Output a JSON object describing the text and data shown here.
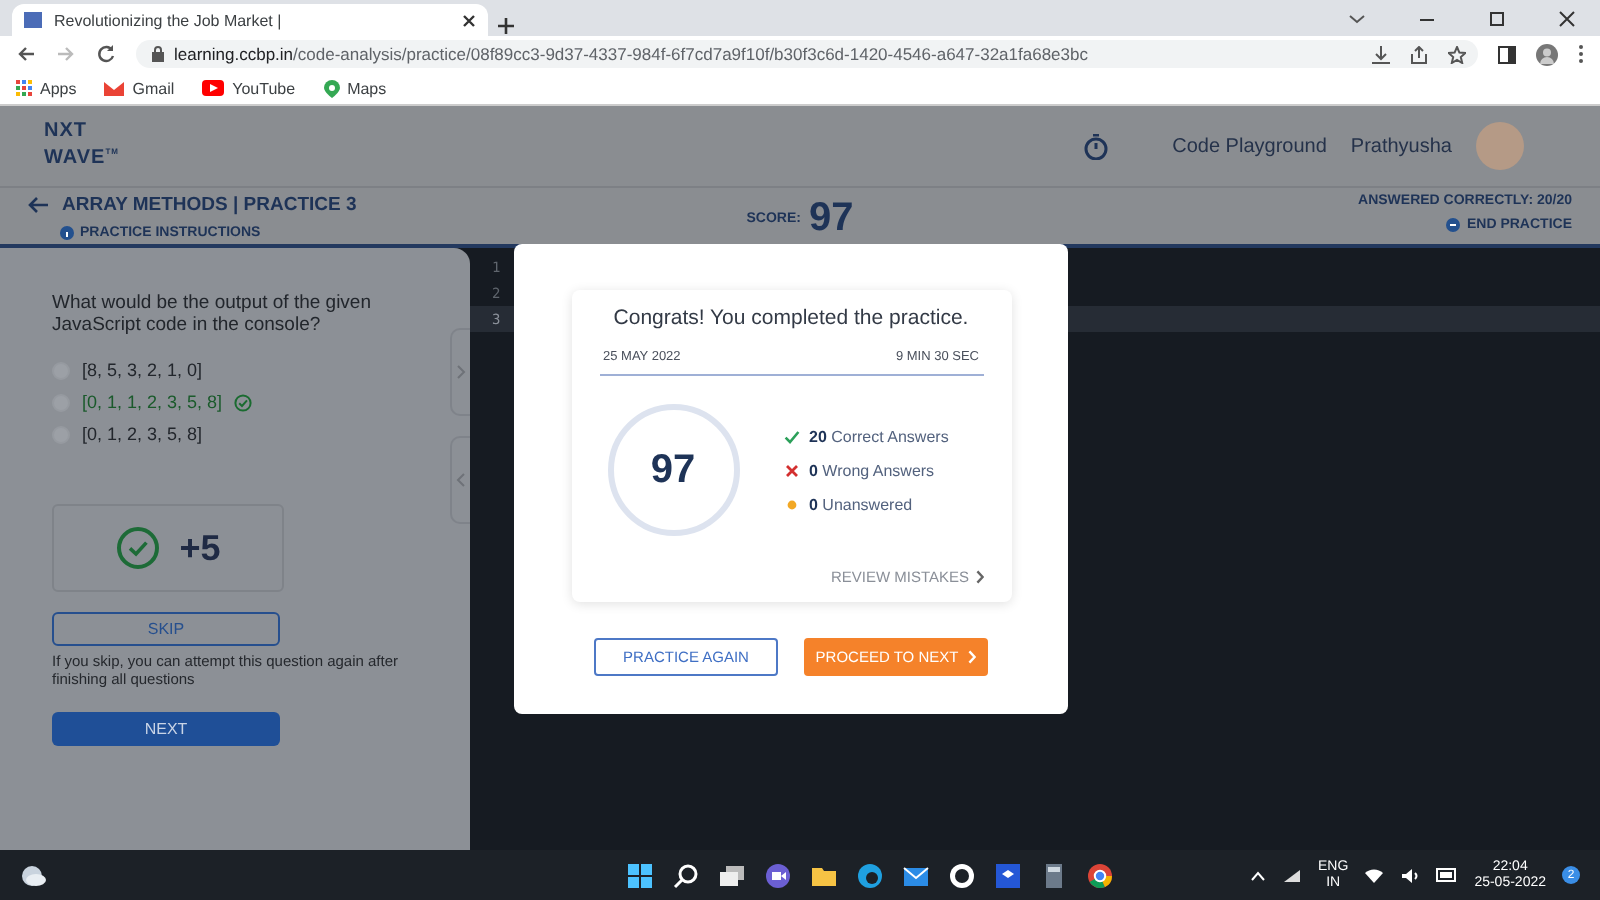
{
  "browser": {
    "tab_title": "Revolutionizing the Job Market |",
    "url_host": "learning.ccbp.in",
    "url_path": "/code-analysis/practice/08f89cc3-9d37-4337-984f-6f7cd7a9f10f/b30f3c6d-1420-4546-a647-32a1fa68e3bc",
    "bookmarks": [
      {
        "kind": "apps",
        "label": "Apps"
      },
      {
        "kind": "gmail",
        "label": "Gmail"
      },
      {
        "kind": "youtube",
        "label": "YouTube"
      },
      {
        "kind": "maps",
        "label": "Maps"
      }
    ]
  },
  "header": {
    "logo": [
      "NXT",
      "WAVE"
    ],
    "logo_mark": "TM",
    "nav_link": "Code Playground",
    "user": "Prathyusha"
  },
  "practice_bar": {
    "title": "ARRAY METHODS | PRACTICE 3",
    "instructions": "PRACTICE INSTRUCTIONS",
    "score_label": "SCORE:",
    "score": "97",
    "answered": "ANSWERED CORRECTLY: 20/20",
    "end": "END PRACTICE"
  },
  "question": {
    "text": "What would be the output of the given JavaScript code in the console?",
    "options": [
      {
        "label": "[8, 5, 3, 2, 1, 0]",
        "correct": false
      },
      {
        "label": "[0, 1, 1, 2, 3, 5, 8]",
        "correct": true
      },
      {
        "label": "[0, 1, 2, 3, 5, 8]",
        "correct": false
      }
    ],
    "points": "+5",
    "skip": "SKIP",
    "skip_note": "If you skip, you can attempt this question again after finishing all questions",
    "next": "NEXT"
  },
  "editor": {
    "lines": [
      {
        "number": "1",
        "selected": false
      },
      {
        "number": "2",
        "selected": false
      },
      {
        "number": "3",
        "selected": true
      }
    ]
  },
  "modal": {
    "title": "Congrats! You completed the practice.",
    "date": "25 MAY 2022",
    "duration": "9 MIN 30 SEC",
    "score": "97",
    "stats": [
      {
        "kind": "correct",
        "count": "20",
        "label": "Correct Answers"
      },
      {
        "kind": "wrong",
        "count": "0",
        "label": "Wrong Answers"
      },
      {
        "kind": "unanswered",
        "count": "0",
        "label": "Unanswered"
      }
    ],
    "review": "REVIEW MISTAKES",
    "practice_again": "PRACTICE AGAIN",
    "proceed": "PROCEED TO NEXT"
  },
  "taskbar": {
    "language": [
      "ENG",
      "IN"
    ],
    "time": "22:04",
    "date": "25-05-2022",
    "notifications": "2"
  }
}
